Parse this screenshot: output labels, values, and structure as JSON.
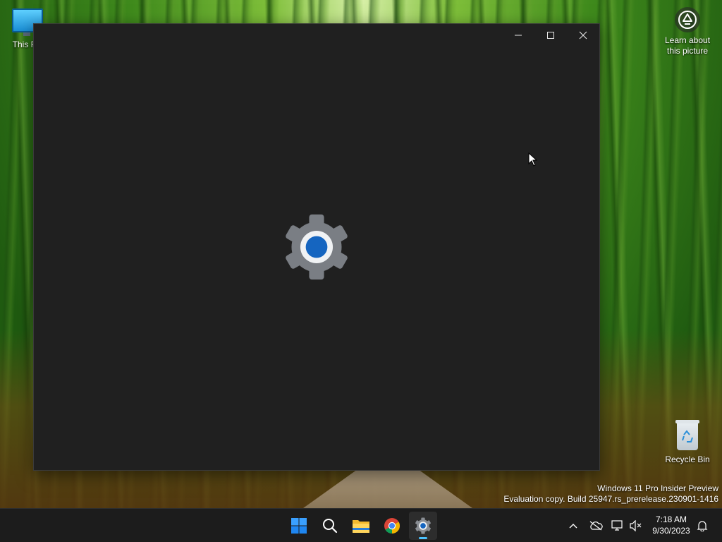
{
  "desktop": {
    "icons": {
      "this_pc": "This PC",
      "learn_about": "Learn about this picture",
      "recycle_bin": "Recycle Bin"
    },
    "watermark": {
      "line1": "Windows 11 Pro Insider Preview",
      "line2": "Evaluation copy. Build 25947.rs_prerelease.230901-1416"
    }
  },
  "window": {
    "app": "Settings",
    "splash_icon": "settings-gear-icon",
    "controls": [
      "minimize-icon",
      "maximize-icon",
      "close-icon"
    ],
    "colors": {
      "background": "#202020",
      "gear_outer": "#7a7e84",
      "gear_center": "#1565c0"
    }
  },
  "taskbar": {
    "apps": [
      "windows-start-icon",
      "search-icon",
      "file-explorer-icon",
      "chrome-icon",
      "settings-icon"
    ],
    "active_app": "settings-icon",
    "tray": {
      "icons": [
        "chevron-up-icon",
        "onedrive-icon",
        "network-icon",
        "volume-muted-icon",
        "notification-bell-icon"
      ],
      "time": "7:18 AM",
      "date": "9/30/2023"
    },
    "accent": "#4cc2ff"
  }
}
